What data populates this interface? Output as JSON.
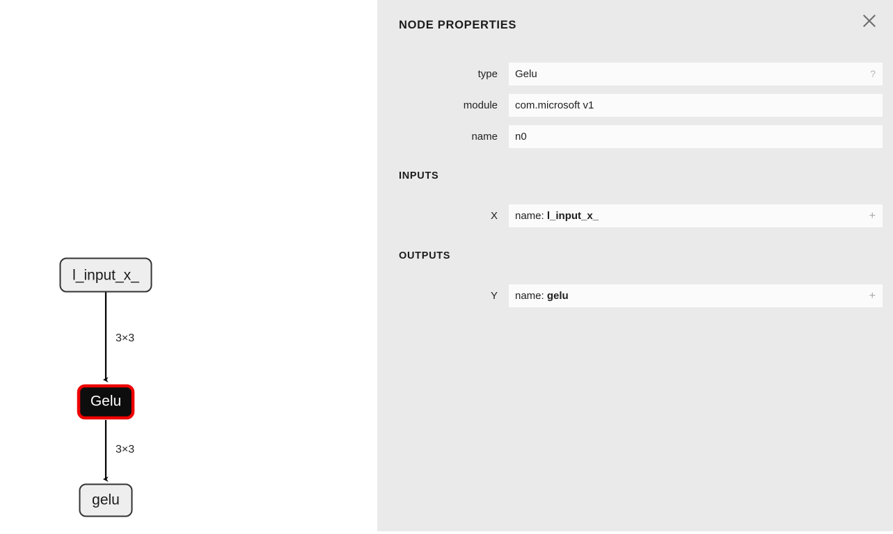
{
  "panel": {
    "title": "NODE PROPERTIES",
    "close_icon": "close-icon",
    "sections": {
      "inputs_heading": "INPUTS",
      "outputs_heading": "OUTPUTS"
    },
    "fields": [
      {
        "label": "type",
        "value": "Gelu",
        "affordance": "?"
      },
      {
        "label": "module",
        "value": "com.microsoft v1",
        "affordance": ""
      },
      {
        "label": "name",
        "value": "n0",
        "affordance": ""
      }
    ],
    "inputs": [
      {
        "label": "X",
        "key": "name: ",
        "value": "l_input_x_",
        "affordance": "+"
      }
    ],
    "outputs": [
      {
        "label": "Y",
        "key": "name: ",
        "value": "gelu",
        "affordance": "+"
      }
    ]
  },
  "graph": {
    "nodes": [
      {
        "id": "input",
        "label": "l_input_x_",
        "kind": "io"
      },
      {
        "id": "op",
        "label": "Gelu",
        "kind": "op-selected"
      },
      {
        "id": "output",
        "label": "gelu",
        "kind": "io"
      }
    ],
    "edges": [
      {
        "from": "input",
        "to": "op",
        "label": "3×3"
      },
      {
        "from": "op",
        "to": "output",
        "label": "3×3"
      }
    ],
    "colors": {
      "node_fill": "#eeeeee",
      "node_stroke": "#333333",
      "selected_fill": "#0d0d0d",
      "selected_stroke": "#ee0000",
      "edge": "#000000"
    }
  }
}
